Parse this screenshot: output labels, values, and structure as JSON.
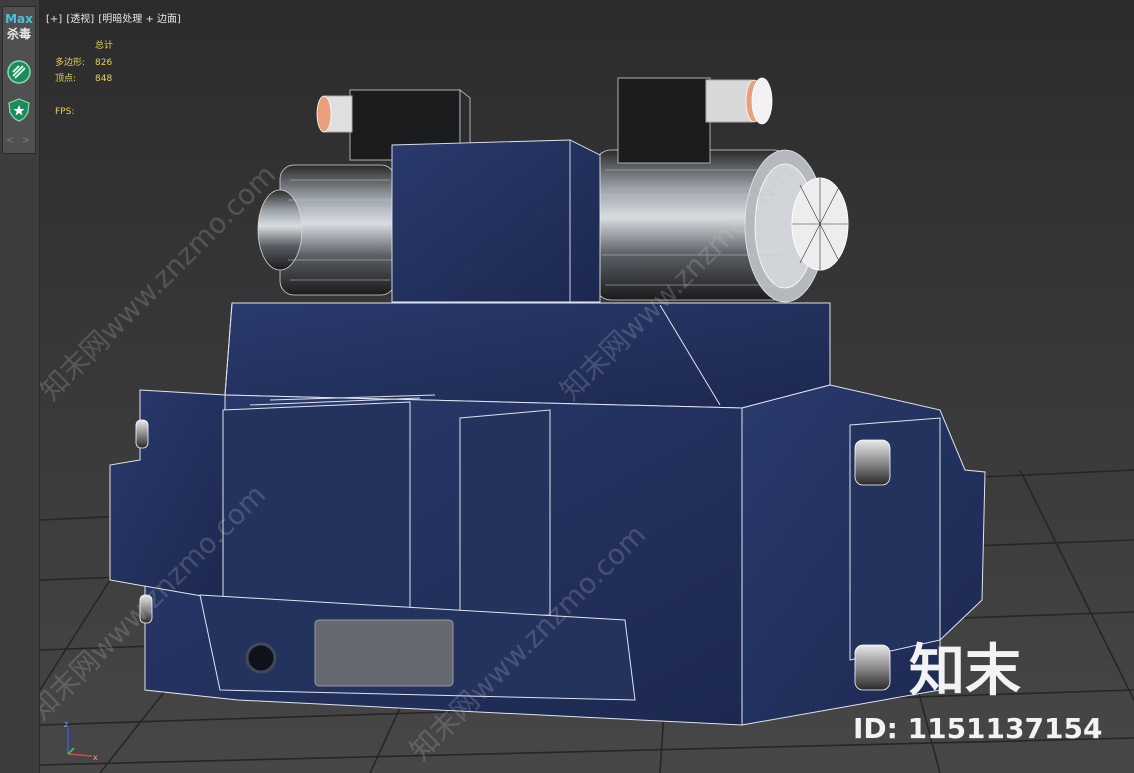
{
  "sidebar": {
    "max_label": "Max",
    "antivirus_label": "杀毒",
    "icons": [
      "scan-icon",
      "shield-icon"
    ],
    "arrows": "< >"
  },
  "viewport": {
    "label_parts": [
      "[+]",
      "[透视]",
      "[明暗处理 + 边面]"
    ],
    "stats": {
      "header": "总计",
      "polygons_label": "多边形:",
      "polygons_value": "826",
      "vertices_label": "顶点:",
      "vertices_value": "848",
      "fps_label": "FPS:"
    },
    "gizmo_labels": {
      "z": "z",
      "x": "x"
    },
    "watermark_text": "知末网www.znzmo.com"
  },
  "brand": {
    "logo": "知末",
    "id_text": "ID: 1151137154"
  },
  "colors": {
    "viewport_bg": "#3a3a3a",
    "model_blue": "#24325e",
    "stats_text": "#e6d25a",
    "sidebar_accent": "#4dc0d8",
    "icon_green": "#1f8a5a"
  }
}
